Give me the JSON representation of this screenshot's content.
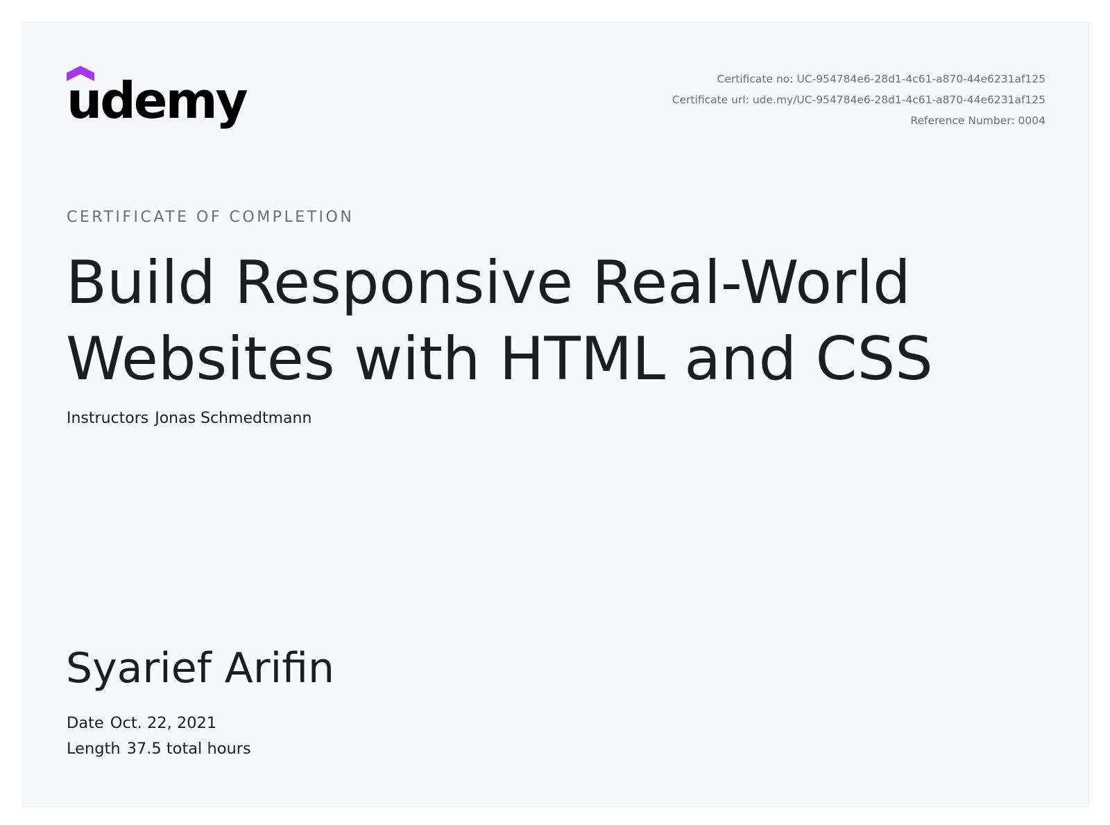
{
  "brand": {
    "name": "udemy",
    "accent_color": "#a435f0",
    "text_color": "#000000"
  },
  "meta": {
    "certificate_no_label": "Certificate no:",
    "certificate_no": "UC-954784e6-28d1-4c61-a870-44e6231af125",
    "certificate_url_label": "Certificate url:",
    "certificate_url": "ude.my/UC-954784e6-28d1-4c61-a870-44e6231af125",
    "reference_label": "Reference Number:",
    "reference_number": "0004"
  },
  "certificate": {
    "eyebrow": "CERTIFICATE OF COMPLETION",
    "title_line1": "Build Responsive Real-World",
    "title_line2": "Websites with HTML and CSS",
    "instructors_label": "Instructors",
    "instructors": "Jonas Schmedtmann",
    "recipient": "Syarief Arifin",
    "date_label": "Date",
    "date": "Oct. 22, 2021",
    "length_label": "Length",
    "length": "37.5 total hours"
  }
}
